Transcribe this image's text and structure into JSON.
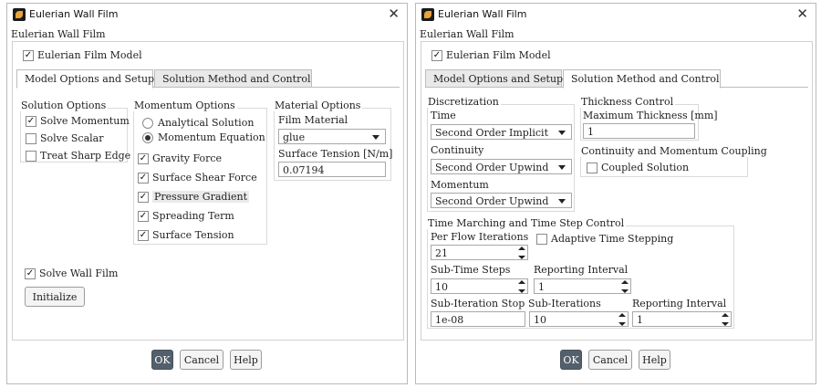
{
  "left": {
    "window_title": "Eulerian Wall Film",
    "heading": "Eulerian Wall Film",
    "film_model_label": "Eulerian Film Model",
    "tabs": [
      "Model Options and Setup",
      "Solution Method and Control"
    ],
    "solution_options": {
      "title": "Solution Options",
      "items": [
        "Solve Momentum",
        "Solve Scalar",
        "Treat Sharp Edge"
      ]
    },
    "momentum_options": {
      "title": "Momentum Options",
      "radios": [
        "Analytical Solution",
        "Momentum Equation"
      ],
      "checks": [
        "Gravity Force",
        "Surface Shear Force",
        "Pressure Gradient",
        "Spreading Term",
        "Surface Tension"
      ]
    },
    "material_options": {
      "title": "Material Options",
      "film_material_label": "Film Material",
      "film_material_value": "glue",
      "surface_tension_label": "Surface Tension [N/m]",
      "surface_tension_value": "0.07194"
    },
    "solve_wall_film_label": "Solve Wall Film",
    "initialize_label": "Initialize",
    "ok": "OK",
    "cancel": "Cancel",
    "help": "Help"
  },
  "right": {
    "window_title": "Eulerian Wall Film",
    "heading": "Eulerian Wall Film",
    "film_model_label": "Eulerian Film Model",
    "tabs": [
      "Model Options and Setup",
      "Solution Method and Control"
    ],
    "discretization": {
      "title": "Discretization",
      "time_label": "Time",
      "time_value": "Second Order Implicit",
      "continuity_label": "Continuity",
      "continuity_value": "Second Order Upwind",
      "momentum_label": "Momentum",
      "momentum_value": "Second Order Upwind"
    },
    "thickness_control": {
      "title": "Thickness Control",
      "max_thickness_label": "Maximum Thickness [mm]",
      "max_thickness_value": "1"
    },
    "coupling": {
      "title": "Continuity and Momentum Coupling",
      "coupled_label": "Coupled Solution"
    },
    "time_marching": {
      "title": "Time Marching and Time Step Control",
      "per_flow_label": "Per Flow Iterations",
      "per_flow_value": "21",
      "adaptive_label": "Adaptive Time Stepping",
      "sub_time_steps_label": "Sub-Time Steps",
      "sub_time_steps_value": "10",
      "reporting_interval_label": "Reporting Interval",
      "reporting_interval_value": "1",
      "sub_iteration_stop_label": "Sub-Iteration Stop",
      "sub_iteration_stop_value": "1e-08",
      "sub_iterations_label": "Sub-Iterations",
      "sub_iterations_value": "10",
      "reporting_interval2_label": "Reporting Interval",
      "reporting_interval2_value": "1"
    },
    "ok": "OK",
    "cancel": "Cancel",
    "help": "Help"
  }
}
